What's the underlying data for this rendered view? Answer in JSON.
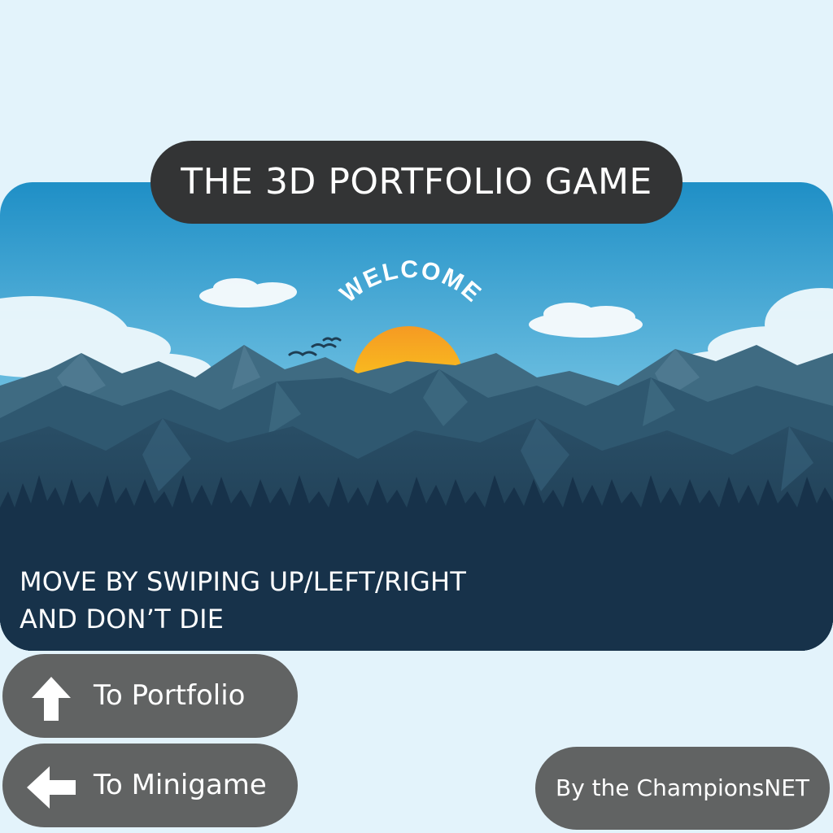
{
  "title": "THE 3D PORTFOLIO GAME",
  "scene": {
    "welcome_text": "WELCOME",
    "colors": {
      "sky_top": "#1f8fc6",
      "sky_bottom": "#bfe6f2",
      "sun_top": "#f59a23",
      "sun_bottom": "#fde21a",
      "mountain_far": "#3f6b82",
      "mountain_mid": "#2f5870",
      "mountain_near": "#1e3e54",
      "forest": "#17324a"
    }
  },
  "instructions": {
    "line1": "MOVE BY SWIPING UP/LEFT/RIGHT",
    "line2": "AND DON’T DIE"
  },
  "buttons": {
    "portfolio": {
      "label": "To Portfolio",
      "icon": "arrow-up-icon"
    },
    "minigame": {
      "label": "To Minigame",
      "icon": "arrow-left-icon"
    }
  },
  "credit": "By the ChampionsNET",
  "colors": {
    "page_background": "#e3f3fb",
    "title_pill": "#333435",
    "button": "#616363",
    "text": "#ffffff"
  }
}
